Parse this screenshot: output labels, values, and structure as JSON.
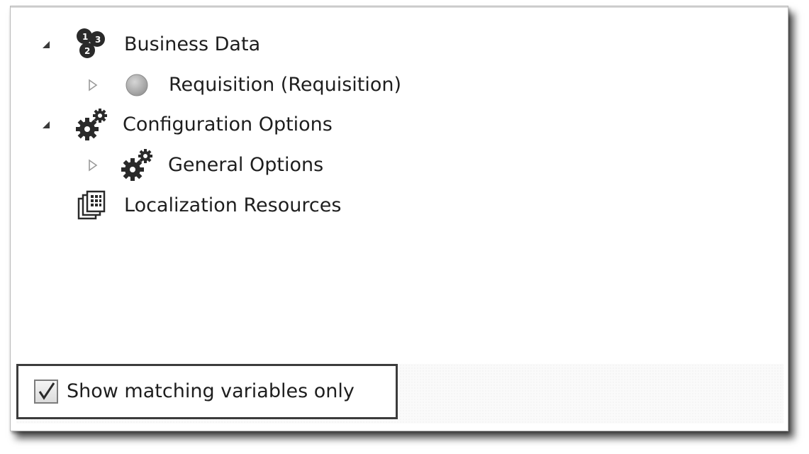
{
  "tree": {
    "items": [
      {
        "label": "Business Data",
        "expanded": true,
        "icon": "business-data-icon"
      },
      {
        "label": "Requisition (Requisition)",
        "expanded": false,
        "icon": "variable-circle-icon"
      },
      {
        "label": "Configuration Options",
        "expanded": true,
        "icon": "gears-icon"
      },
      {
        "label": "General Options",
        "expanded": false,
        "icon": "gears-icon"
      },
      {
        "label": "Localization Resources",
        "icon": "resources-icon"
      }
    ]
  },
  "filter": {
    "show_matching_label": "Show matching variables only",
    "checked": true
  },
  "colors": {
    "text": "#1e1e1e",
    "border": "#3c3c3c",
    "icon_dark": "#2a2a2a",
    "icon_gray": "#a0a0a0"
  }
}
